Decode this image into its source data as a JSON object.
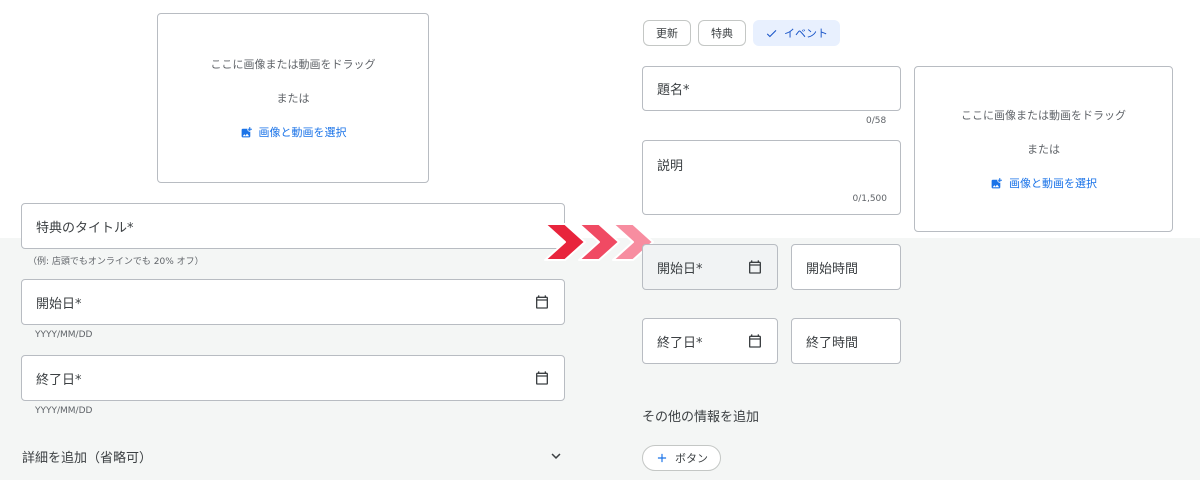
{
  "left": {
    "upload": {
      "drag_text": "ここに画像または動画をドラッグ",
      "or_text": "または",
      "select_label": "画像と動画を選択"
    },
    "title_field": {
      "label": "特典のタイトル*",
      "helper": "（例: 店頭でもオンラインでも 20% オフ）"
    },
    "start_date": {
      "label": "開始日*",
      "helper": "YYYY/MM/DD"
    },
    "end_date": {
      "label": "終了日*",
      "helper": "YYYY/MM/DD"
    },
    "details": {
      "label": "詳細を追加（省略可）"
    }
  },
  "right": {
    "chips": [
      {
        "label": "更新",
        "selected": false
      },
      {
        "label": "特典",
        "selected": false
      },
      {
        "label": "イベント",
        "selected": true
      }
    ],
    "title_field": {
      "label": "題名*",
      "counter": "0/58"
    },
    "desc_field": {
      "label": "説明",
      "counter": "0/1,500"
    },
    "upload": {
      "drag_text": "ここに画像または動画をドラッグ",
      "or_text": "または",
      "select_label": "画像と動画を選択"
    },
    "start_date": {
      "label": "開始日*"
    },
    "start_time": {
      "label": "開始時間"
    },
    "end_date": {
      "label": "終了日*"
    },
    "end_time": {
      "label": "終了時間"
    },
    "more_info": {
      "label": "その他の情報を追加"
    },
    "add_button": {
      "label": "ボタン"
    }
  },
  "colors": {
    "accent": "#1a73e8",
    "arrow_1": "#e8243c",
    "arrow_2": "#f04a63",
    "arrow_3": "#f78da0",
    "bottom_bg": "#f4f6f5"
  }
}
